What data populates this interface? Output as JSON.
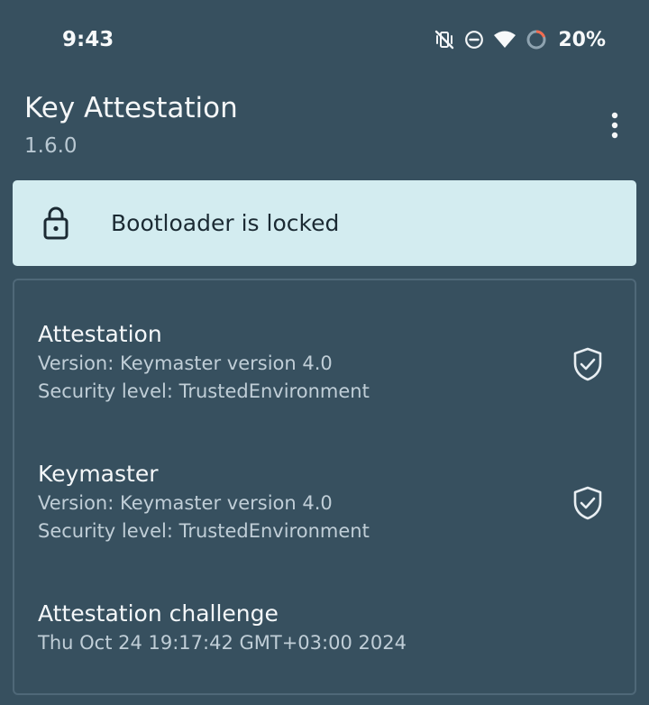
{
  "status_bar": {
    "time": "9:43",
    "battery": "20%",
    "icons": [
      "vibrate-off-icon",
      "do-not-disturb-icon",
      "wifi-icon",
      "battery-ring-icon"
    ]
  },
  "app": {
    "title": "Key Attestation",
    "version": "1.6.0",
    "menu_icon": "more-vert-icon"
  },
  "bootloader": {
    "icon": "lock-icon",
    "text": "Bootloader is locked"
  },
  "sections": [
    {
      "title": "Attestation",
      "lines": [
        "Version: Keymaster version 4.0",
        "Security level: TrustedEnvironment"
      ],
      "icon": "shield-check-icon"
    },
    {
      "title": "Keymaster",
      "lines": [
        "Version: Keymaster version 4.0",
        "Security level: TrustedEnvironment"
      ],
      "icon": "shield-check-icon"
    },
    {
      "title": "Attestation challenge",
      "lines": [
        "Thu Oct 24 19:17:42 GMT+03:00 2024"
      ]
    }
  ],
  "colors": {
    "background": "#37505f",
    "banner": "#d3ecf0",
    "accent_battery": "#f26b4f"
  }
}
